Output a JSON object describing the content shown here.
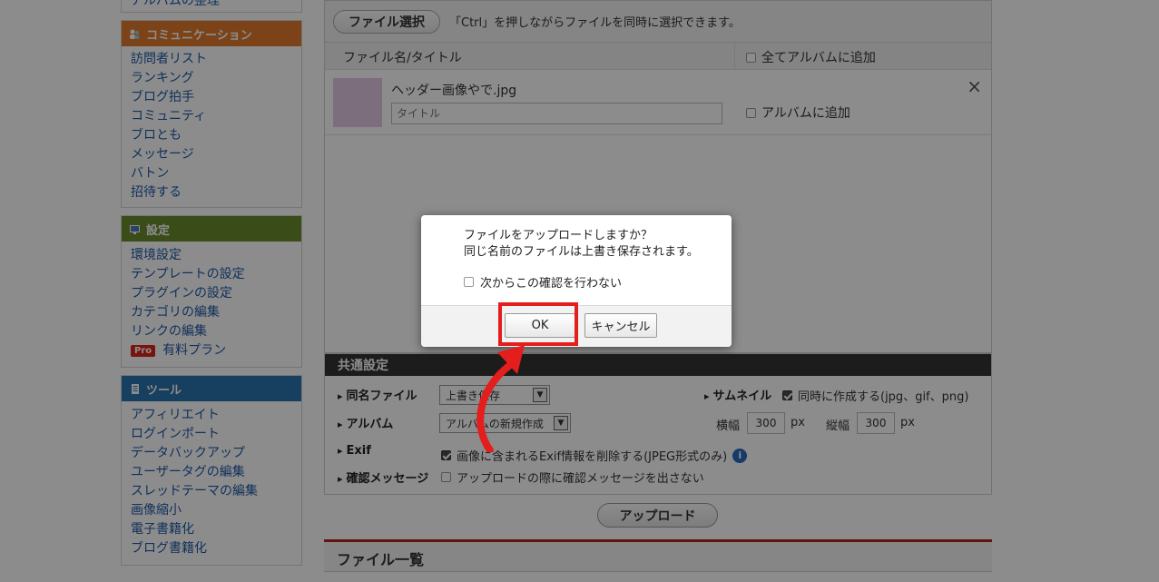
{
  "sidebar": {
    "top_partial_link": "アルバムの整理",
    "communication": {
      "title": "コミュニケーション",
      "color": "#e07b2b",
      "items": [
        "訪問者リスト",
        "ランキング",
        "ブログ拍手",
        "コミュニティ",
        "ブロとも",
        "メッセージ",
        "バトン",
        "招待する"
      ]
    },
    "settings": {
      "title": "設定",
      "color": "#6a8a2c",
      "items": [
        "環境設定",
        "テンプレートの設定",
        "プラグインの設定",
        "カテゴリの編集",
        "リンクの編集"
      ],
      "pro_badge": "Pro",
      "pro_label": "有料プラン"
    },
    "tools": {
      "title": "ツール",
      "color": "#2a73b0",
      "items": [
        "アフィリエイト",
        "ログインポート",
        "データバックアップ",
        "ユーザータグの編集",
        "スレッドテーマの編集",
        "画像縮小",
        "電子書籍化",
        "ブログ書籍化"
      ]
    }
  },
  "upload": {
    "file_select_label": "ファイル選択",
    "hint": "「Ctrl」を押しながらファイルを同時に選択できます。",
    "col_filename": "ファイル名/タイトル",
    "col_add_all": "全てアルバムに追加",
    "file": {
      "name": "ヘッダー画像やで.jpg",
      "title_placeholder": "タイトル",
      "add_album_label": "アルバムに追加",
      "remove_icon": "×"
    }
  },
  "common_settings": {
    "title": "共通設定",
    "same_name_label": "同名ファイル",
    "same_name_value": "上書き保存",
    "album_label": "アルバム",
    "album_value": "アルバムの新規作成",
    "exif_label": "Exif",
    "exif_text": "画像に含まれるExif情報を削除する(JPEG形式のみ)",
    "exif_checked": true,
    "confirm_label": "確認メッセージ",
    "confirm_text": "アップロードの際に確認メッセージを出さない",
    "confirm_checked": false,
    "thumbnail_label": "サムネイル",
    "thumbnail_text": "同時に作成する(jpg、gif、png)",
    "thumbnail_checked": true,
    "width_label": "横幅",
    "width_value": "300",
    "height_label": "縦幅",
    "height_value": "300",
    "unit": "px"
  },
  "upload_button_label": "アップロード",
  "file_list_title": "ファイル一覧",
  "dialog": {
    "line1": "ファイルをアップロードしますか？",
    "line2": "同じ名前のファイルは上書き保存されます。",
    "checkbox_label": "次からこの確認を行わない",
    "ok_label": "OK",
    "cancel_label": "キャンセル",
    "highlight_color": "#e41d1d"
  }
}
